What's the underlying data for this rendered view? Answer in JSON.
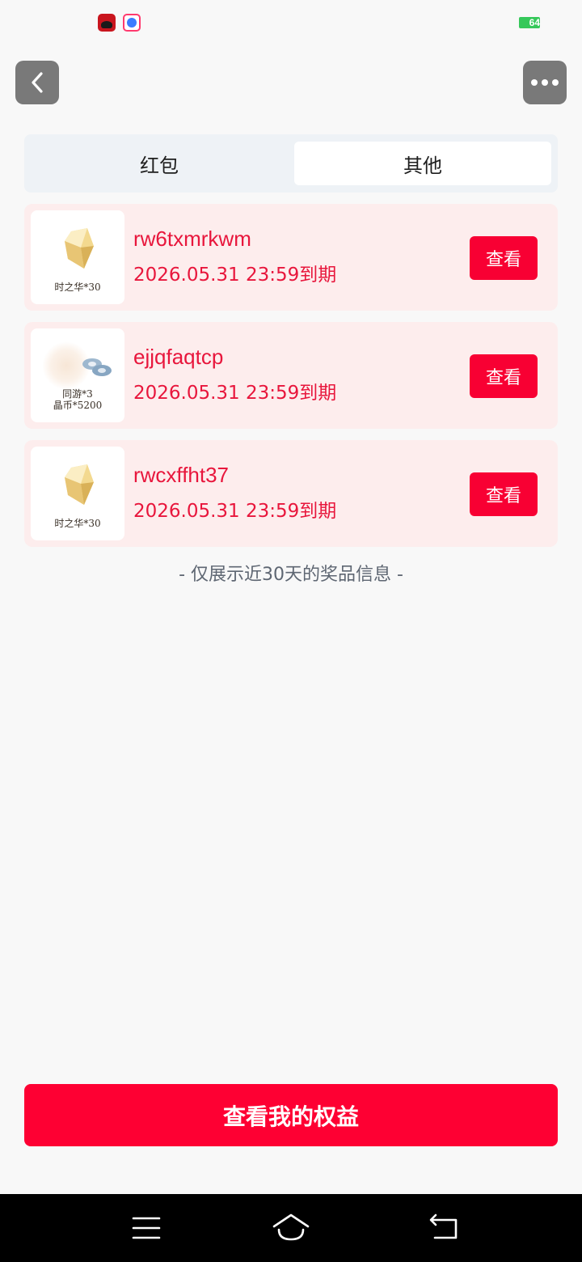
{
  "status_bar": {
    "battery_level": "64",
    "battery_color": "#36c85a",
    "notification_icons": [
      "red-app-icon",
      "cartoon-app-icon"
    ]
  },
  "header": {
    "back_icon": "chevron-left-icon",
    "more_icon": "more-dots-icon"
  },
  "tabs": [
    {
      "label": "红包",
      "selected": false
    },
    {
      "label": "其他",
      "selected": true
    }
  ],
  "prizes": [
    {
      "thumb_caption_lines": [
        "时之华*30"
      ],
      "code": "rw6txmrkwm",
      "expiry": "2026.05.31 23:59到期",
      "action_label": "查看"
    },
    {
      "thumb_caption_lines": [
        "同游*3",
        "晶币*5200"
      ],
      "code": "ejjqfaqtcp",
      "expiry": "2026.05.31 23:59到期",
      "action_label": "查看"
    },
    {
      "thumb_caption_lines": [
        "时之华*30"
      ],
      "code": "rwcxffht37",
      "expiry": "2026.05.31 23:59到期",
      "action_label": "查看"
    }
  ],
  "footer_note": "- 仅展示近30天的奖品信息 -",
  "main_button_label": "查看我的权益",
  "colors": {
    "accent": "#f80033",
    "card_background": "#fdeded",
    "text_accent": "#e8163c"
  },
  "system_nav": [
    "menu-icon",
    "home-icon",
    "back-icon"
  ]
}
